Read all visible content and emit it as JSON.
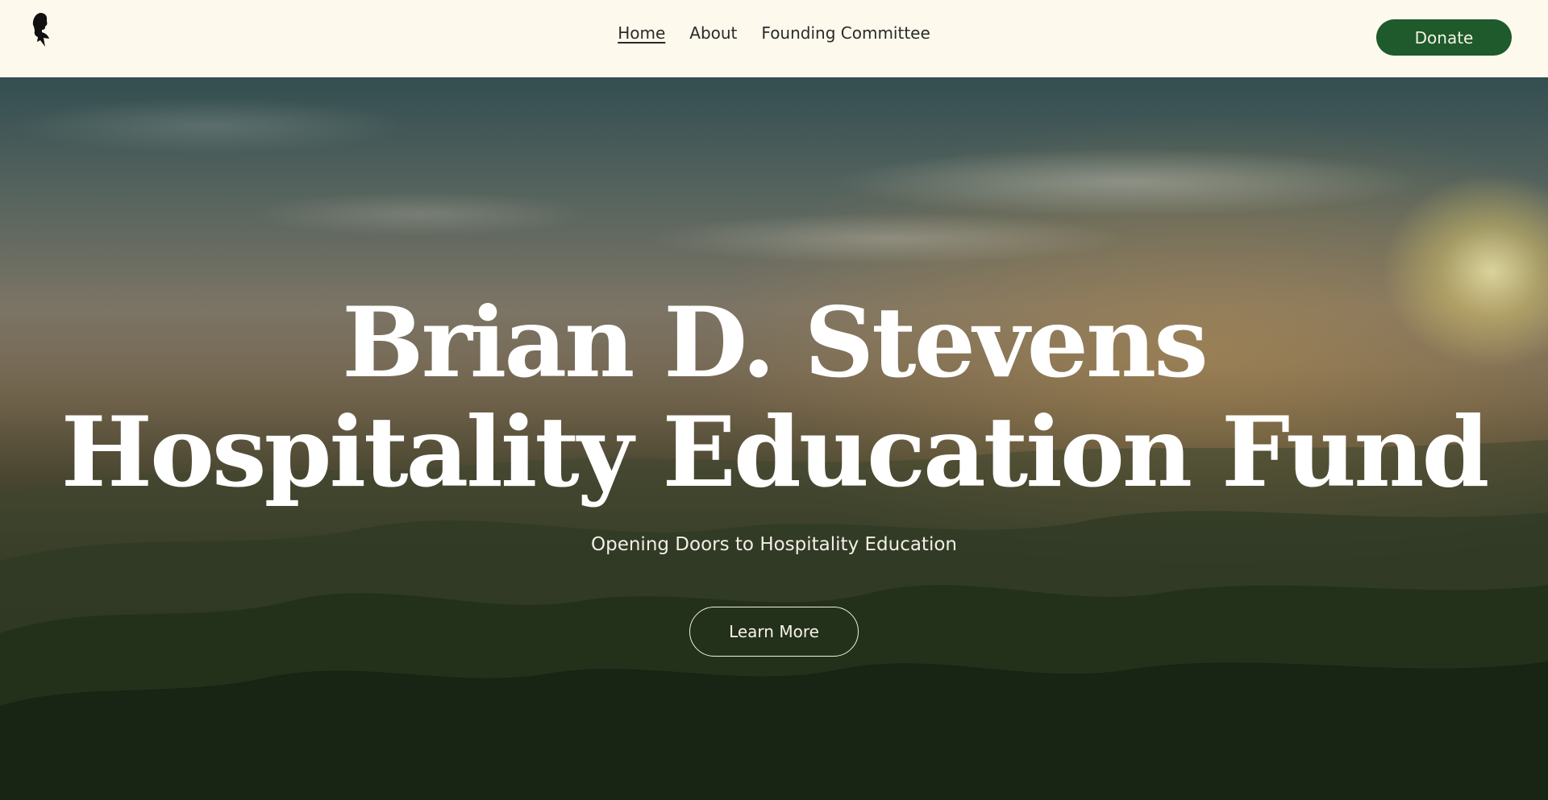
{
  "header": {
    "logo_icon": "silhouette-portrait-icon",
    "nav": [
      {
        "label": "Home",
        "active": true
      },
      {
        "label": "About",
        "active": false
      },
      {
        "label": "Founding Committee",
        "active": false
      }
    ],
    "donate_label": "Donate"
  },
  "hero": {
    "title_line1": "Brian D. Stevens",
    "title_line2": "Hospitality Education Fund",
    "subtitle": "Opening Doors to Hospitality Education",
    "cta_label": "Learn More"
  },
  "colors": {
    "header_bg": "#fdf9ec",
    "accent_green": "#1e5a2b",
    "hero_text": "#ffffff"
  }
}
